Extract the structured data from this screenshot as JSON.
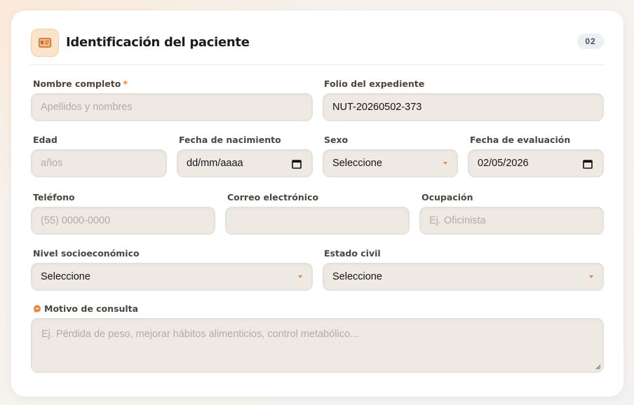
{
  "section": {
    "title": "Identificación del paciente",
    "step": "02"
  },
  "fields": {
    "nombre": {
      "label": "Nombre completo",
      "required_mark": "*",
      "placeholder": "Apellidos y nombres"
    },
    "folio": {
      "label": "Folio del expediente",
      "value": "NUT-20260502-373"
    },
    "edad": {
      "label": "Edad",
      "placeholder": "años"
    },
    "fecha_nacimiento": {
      "label": "Fecha de nacimiento",
      "value": "dd/mm/aaaa"
    },
    "sexo": {
      "label": "Sexo",
      "value": "Seleccione"
    },
    "fecha_evaluacion": {
      "label": "Fecha de evaluación",
      "value": "02/05/2026"
    },
    "telefono": {
      "label": "Teléfono",
      "placeholder": "(55) 0000-0000"
    },
    "correo": {
      "label": "Correo electrónico",
      "placeholder": ""
    },
    "ocupacion": {
      "label": "Ocupación",
      "placeholder": "Ej. Oficinista"
    },
    "nivel_socioeconomico": {
      "label": "Nivel socioeconómico",
      "value": "Seleccione"
    },
    "estado_civil": {
      "label": "Estado civil",
      "value": "Seleccione"
    },
    "motivo": {
      "label": "Motivo de consulta",
      "placeholder": "Ej. Pérdida de peso, mejorar hábitos alimenticios, control metabólico..."
    }
  },
  "icons": {
    "header": "id-card-icon",
    "motivo": "chat-bubble-icon",
    "date": "calendar-icon",
    "dropdown": "chevron-down-icon"
  },
  "colors": {
    "accent": "#e8843b",
    "field_bg": "#efe9e4",
    "header_icon_bg": "#fbe4c9"
  }
}
